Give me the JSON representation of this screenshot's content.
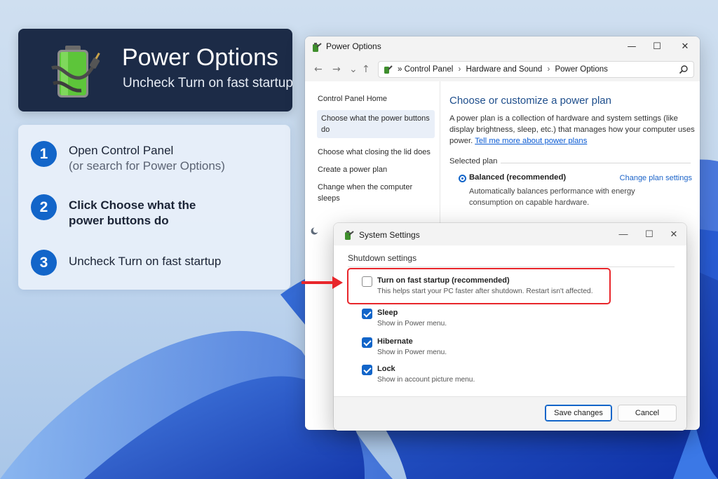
{
  "hero": {
    "title": "Power Options",
    "subtitle": "Uncheck Turn on fast startup",
    "icon": "battery-plug-icon"
  },
  "steps": [
    {
      "number": "1",
      "text": "Open Control Panel",
      "subtext": "(or search for Power Options)"
    },
    {
      "number": "2",
      "text_line1": "Click Choose what the",
      "text_line2": "power buttons do"
    },
    {
      "number": "3",
      "text": "Uncheck Turn on fast startup"
    }
  ],
  "window": {
    "title": "Power Options",
    "controls": {
      "minimize": "—",
      "maximize": "☐",
      "close": "✕"
    },
    "nav": {
      "back": "←",
      "forward": "→",
      "up": "↑"
    },
    "breadcrumb": {
      "separator": "»",
      "items": [
        "Control Panel",
        "Hardware and Sound",
        "Power Options"
      ],
      "arrow": "›"
    },
    "left_pane": {
      "items": [
        "Control Panel Home",
        "Choose what the power buttons do",
        "Choose what closing the lid does",
        "Create a power plan",
        "Change when the computer sleeps"
      ]
    },
    "main": {
      "title": "Choose or customize a power plan",
      "description": "A power plan is a collection of hardware and system settings (like display brightness, sleep, etc.) that manages how your computer uses power.",
      "link": "Tell me more about power plans",
      "selected_plan_label": "Selected plan",
      "plan_name": "Balanced (recommended)",
      "change_plan": "Change plan settings",
      "plan_description": "Automatically balances performance with energy consumption on capable hardware."
    }
  },
  "dialog": {
    "title": "System Settings",
    "controls": {
      "minimize": "—",
      "maximize": "☐",
      "close": "✕"
    },
    "section": "Shutdown settings",
    "options": [
      {
        "label": "Turn on fast startup (recommended)",
        "desc": "This helps start your PC faster after shutdown. Restart isn't affected.",
        "checked": false
      },
      {
        "label": "Sleep",
        "desc": "Show in Power menu.",
        "checked": true
      },
      {
        "label": "Hibernate",
        "desc": "Show in Power menu.",
        "checked": true
      },
      {
        "label": "Lock",
        "desc": "Show in account picture menu.",
        "checked": true
      }
    ],
    "save_label": "Save changes",
    "cancel_label": "Cancel"
  },
  "colors": {
    "accent": "#1265c9",
    "highlight": "#e8262b",
    "hero_bg": "#1c2b47",
    "link": "#0b5bd3"
  }
}
